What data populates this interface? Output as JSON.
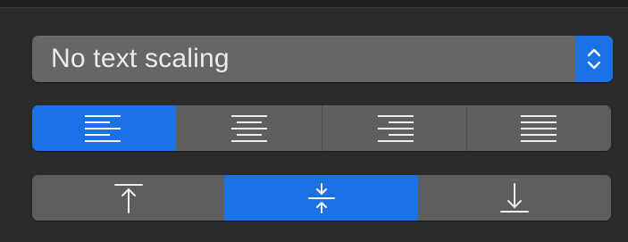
{
  "popup": {
    "selected_value": "No text scaling",
    "stepper_icon": "chevron-up-down-icon"
  },
  "horizontal_alignment": {
    "options": [
      {
        "icon": "align-left-icon",
        "selected": true
      },
      {
        "icon": "align-center-icon",
        "selected": false
      },
      {
        "icon": "align-right-icon",
        "selected": false
      },
      {
        "icon": "align-justify-icon",
        "selected": false
      }
    ]
  },
  "vertical_alignment": {
    "options": [
      {
        "icon": "align-top-icon",
        "selected": false
      },
      {
        "icon": "align-middle-icon",
        "selected": true
      },
      {
        "icon": "align-bottom-icon",
        "selected": false
      }
    ]
  },
  "colors": {
    "accent": "#1a72e6",
    "control_bg": "#5e5e5e",
    "panel_bg": "#2b2b2b",
    "text": "#ececec"
  }
}
